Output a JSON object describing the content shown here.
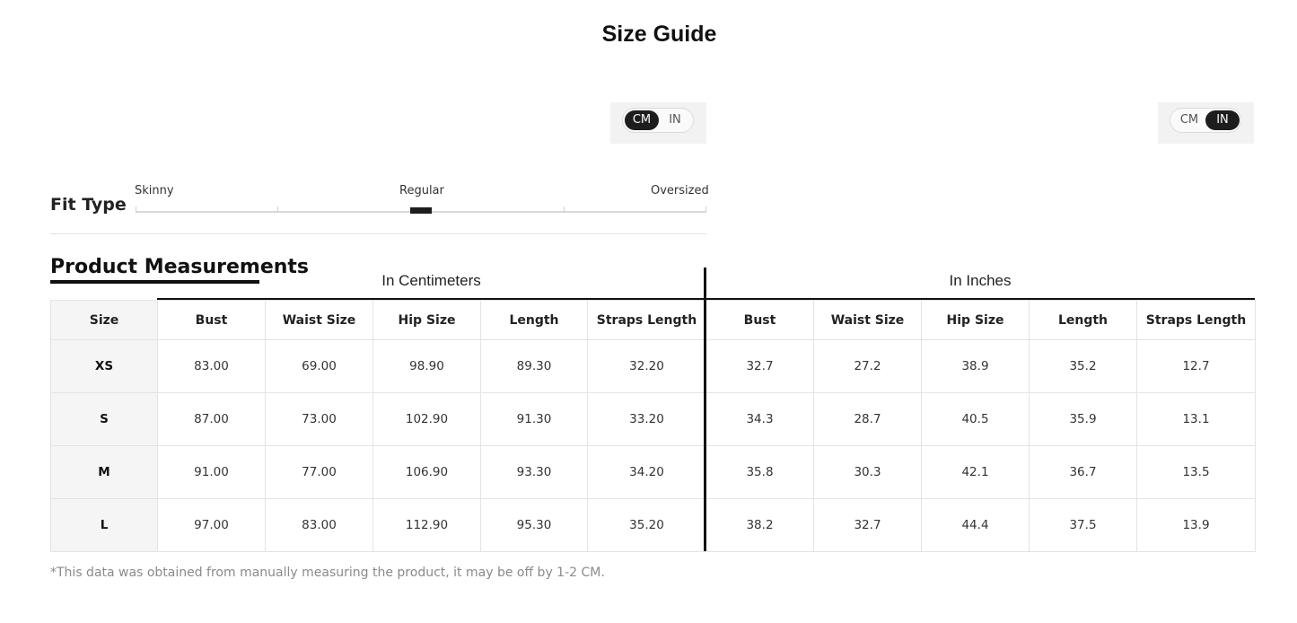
{
  "title": "Size Guide",
  "unit_toggle_left": {
    "options": [
      "CM",
      "IN"
    ],
    "active": "CM"
  },
  "unit_toggle_right": {
    "options": [
      "CM",
      "IN"
    ],
    "active": "IN"
  },
  "fit_type": {
    "label": "Fit Type",
    "scale": [
      "Skinny",
      "Regular",
      "Oversized"
    ],
    "selected": "Regular",
    "position": 0.5
  },
  "measurements": {
    "title": "Product Measurements",
    "group_cm": "In Centimeters",
    "group_in": "In Inches",
    "size_header": "Size",
    "headers_cm": [
      "Bust",
      "Waist Size",
      "Hip Size",
      "Length",
      "Straps Length"
    ],
    "headers_in": [
      "Bust",
      "Waist Size",
      "Hip Size",
      "Length",
      "Straps Length"
    ],
    "rows": [
      {
        "size": "XS",
        "cm": [
          "83.00",
          "69.00",
          "98.90",
          "89.30",
          "32.20"
        ],
        "in": [
          "32.7",
          "27.2",
          "38.9",
          "35.2",
          "12.7"
        ]
      },
      {
        "size": "S",
        "cm": [
          "87.00",
          "73.00",
          "102.90",
          "91.30",
          "33.20"
        ],
        "in": [
          "34.3",
          "28.7",
          "40.5",
          "35.9",
          "13.1"
        ]
      },
      {
        "size": "M",
        "cm": [
          "91.00",
          "77.00",
          "106.90",
          "93.30",
          "34.20"
        ],
        "in": [
          "35.8",
          "30.3",
          "42.1",
          "36.7",
          "13.5"
        ]
      },
      {
        "size": "L",
        "cm": [
          "97.00",
          "83.00",
          "112.90",
          "95.30",
          "35.20"
        ],
        "in": [
          "38.2",
          "32.7",
          "44.4",
          "37.5",
          "13.9"
        ]
      }
    ]
  },
  "footnote": "*This data was obtained from manually measuring the product, it may be off by 1-2 CM."
}
